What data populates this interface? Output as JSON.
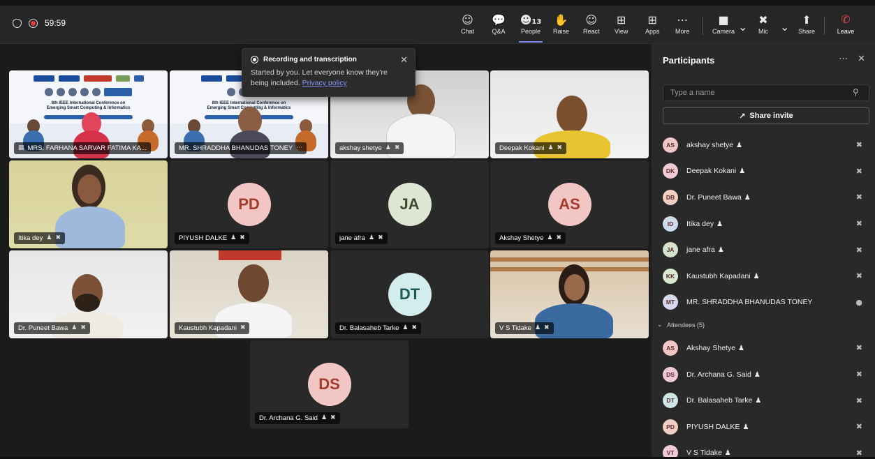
{
  "timer": "59:59",
  "toolbar": {
    "chat": "Chat",
    "qa": "Q&A",
    "people": "People",
    "people_count": "13",
    "raise": "Raise",
    "react": "React",
    "view": "View",
    "apps": "Apps",
    "more": "More",
    "camera": "Camera",
    "mic": "Mic",
    "share": "Share",
    "leave": "Leave"
  },
  "popup": {
    "title": "Recording and transcription",
    "body": "Started by you. Let everyone know they're being included.",
    "link": "Privacy policy"
  },
  "tiles": [
    {
      "name": "MRS. FARHANA SARVAR FATIMA KA..."
    },
    {
      "name": "MR. SHRADDHA BHANUDAS TONEY"
    },
    {
      "name": "akshay shetye"
    },
    {
      "name": "Deepak Kokani"
    },
    {
      "name": "Itika dey"
    },
    {
      "name": "PIYUSH DALKE",
      "initials": "PD"
    },
    {
      "name": "jane afra",
      "initials": "JA"
    },
    {
      "name": "Akshay Shetye",
      "initials": "AS"
    },
    {
      "name": "Dr. Puneet Bawa"
    },
    {
      "name": "Kaustubh Kapadani"
    },
    {
      "name": "Dr. Balasaheb Tarke",
      "initials": "DT"
    },
    {
      "name": "V S Tidake"
    },
    {
      "name": "Dr. Archana G. Said",
      "initials": "DS"
    }
  ],
  "panel": {
    "title": "Participants",
    "search_placeholder": "Type a name",
    "share_invite": "Share invite",
    "attendees_label": "Attendees (5)",
    "presenters": [
      {
        "initials": "AS",
        "name": "akshay shetye",
        "color": "#f3c6c6"
      },
      {
        "initials": "DK",
        "name": "Deepak Kokani",
        "color": "#f0c9d5"
      },
      {
        "initials": "DB",
        "name": "Dr. Puneet Bawa",
        "color": "#f2cfc2"
      },
      {
        "initials": "ID",
        "name": "Itika dey",
        "color": "#cfdcf0"
      },
      {
        "initials": "JA",
        "name": "jane afra",
        "color": "#d6e4cf"
      },
      {
        "initials": "KK",
        "name": "Kaustubh Kapadani",
        "color": "#d9ead0"
      },
      {
        "initials": "MT",
        "name": "MR. SHRADDHA BHANUDAS TONEY",
        "color": "#d6d8ef"
      }
    ],
    "attendees": [
      {
        "initials": "AS",
        "name": "Akshay Shetye",
        "color": "#f3c6c6"
      },
      {
        "initials": "DS",
        "name": "Dr. Archana G. Said",
        "color": "#f0c9d5"
      },
      {
        "initials": "DT",
        "name": "Dr. Balasaheb Tarke",
        "color": "#cfe6e6"
      },
      {
        "initials": "PD",
        "name": "PIYUSH DALKE",
        "color": "#f2cfc2"
      },
      {
        "initials": "VT",
        "name": "V S Tidake",
        "color": "#f0c9d5"
      }
    ]
  },
  "colors": {
    "accent": "#7f85f5",
    "recording": "#e5383b",
    "leave": "#e0464d"
  }
}
